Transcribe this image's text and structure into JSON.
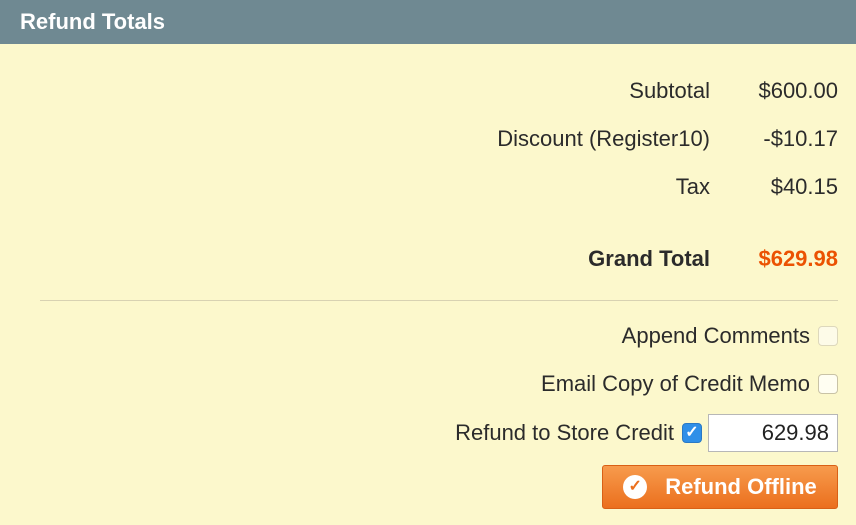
{
  "header": {
    "title": "Refund Totals"
  },
  "totals": {
    "subtotal": {
      "label": "Subtotal",
      "value": "$600.00"
    },
    "discount": {
      "label": "Discount (Register10)",
      "value": "-$10.17"
    },
    "tax": {
      "label": "Tax",
      "value": "$40.15"
    },
    "grand_total": {
      "label": "Grand Total",
      "value": "$629.98"
    }
  },
  "options": {
    "append_comments": {
      "label": "Append Comments",
      "checked": false
    },
    "email_copy": {
      "label": "Email Copy of Credit Memo",
      "checked": false
    },
    "store_credit": {
      "label": "Refund to Store Credit",
      "checked": true,
      "amount": "629.98"
    }
  },
  "actions": {
    "refund_offline": "Refund Offline"
  },
  "colors": {
    "header_bg": "#6f8992",
    "panel_bg": "#fcf8cc",
    "accent": "#eb5202",
    "button": "#eb6f1d",
    "checkbox_checked": "#2f8fe8"
  },
  "icons": {
    "button_icon": "check-circle-icon",
    "checkbox_icon": "checkmark-icon"
  }
}
